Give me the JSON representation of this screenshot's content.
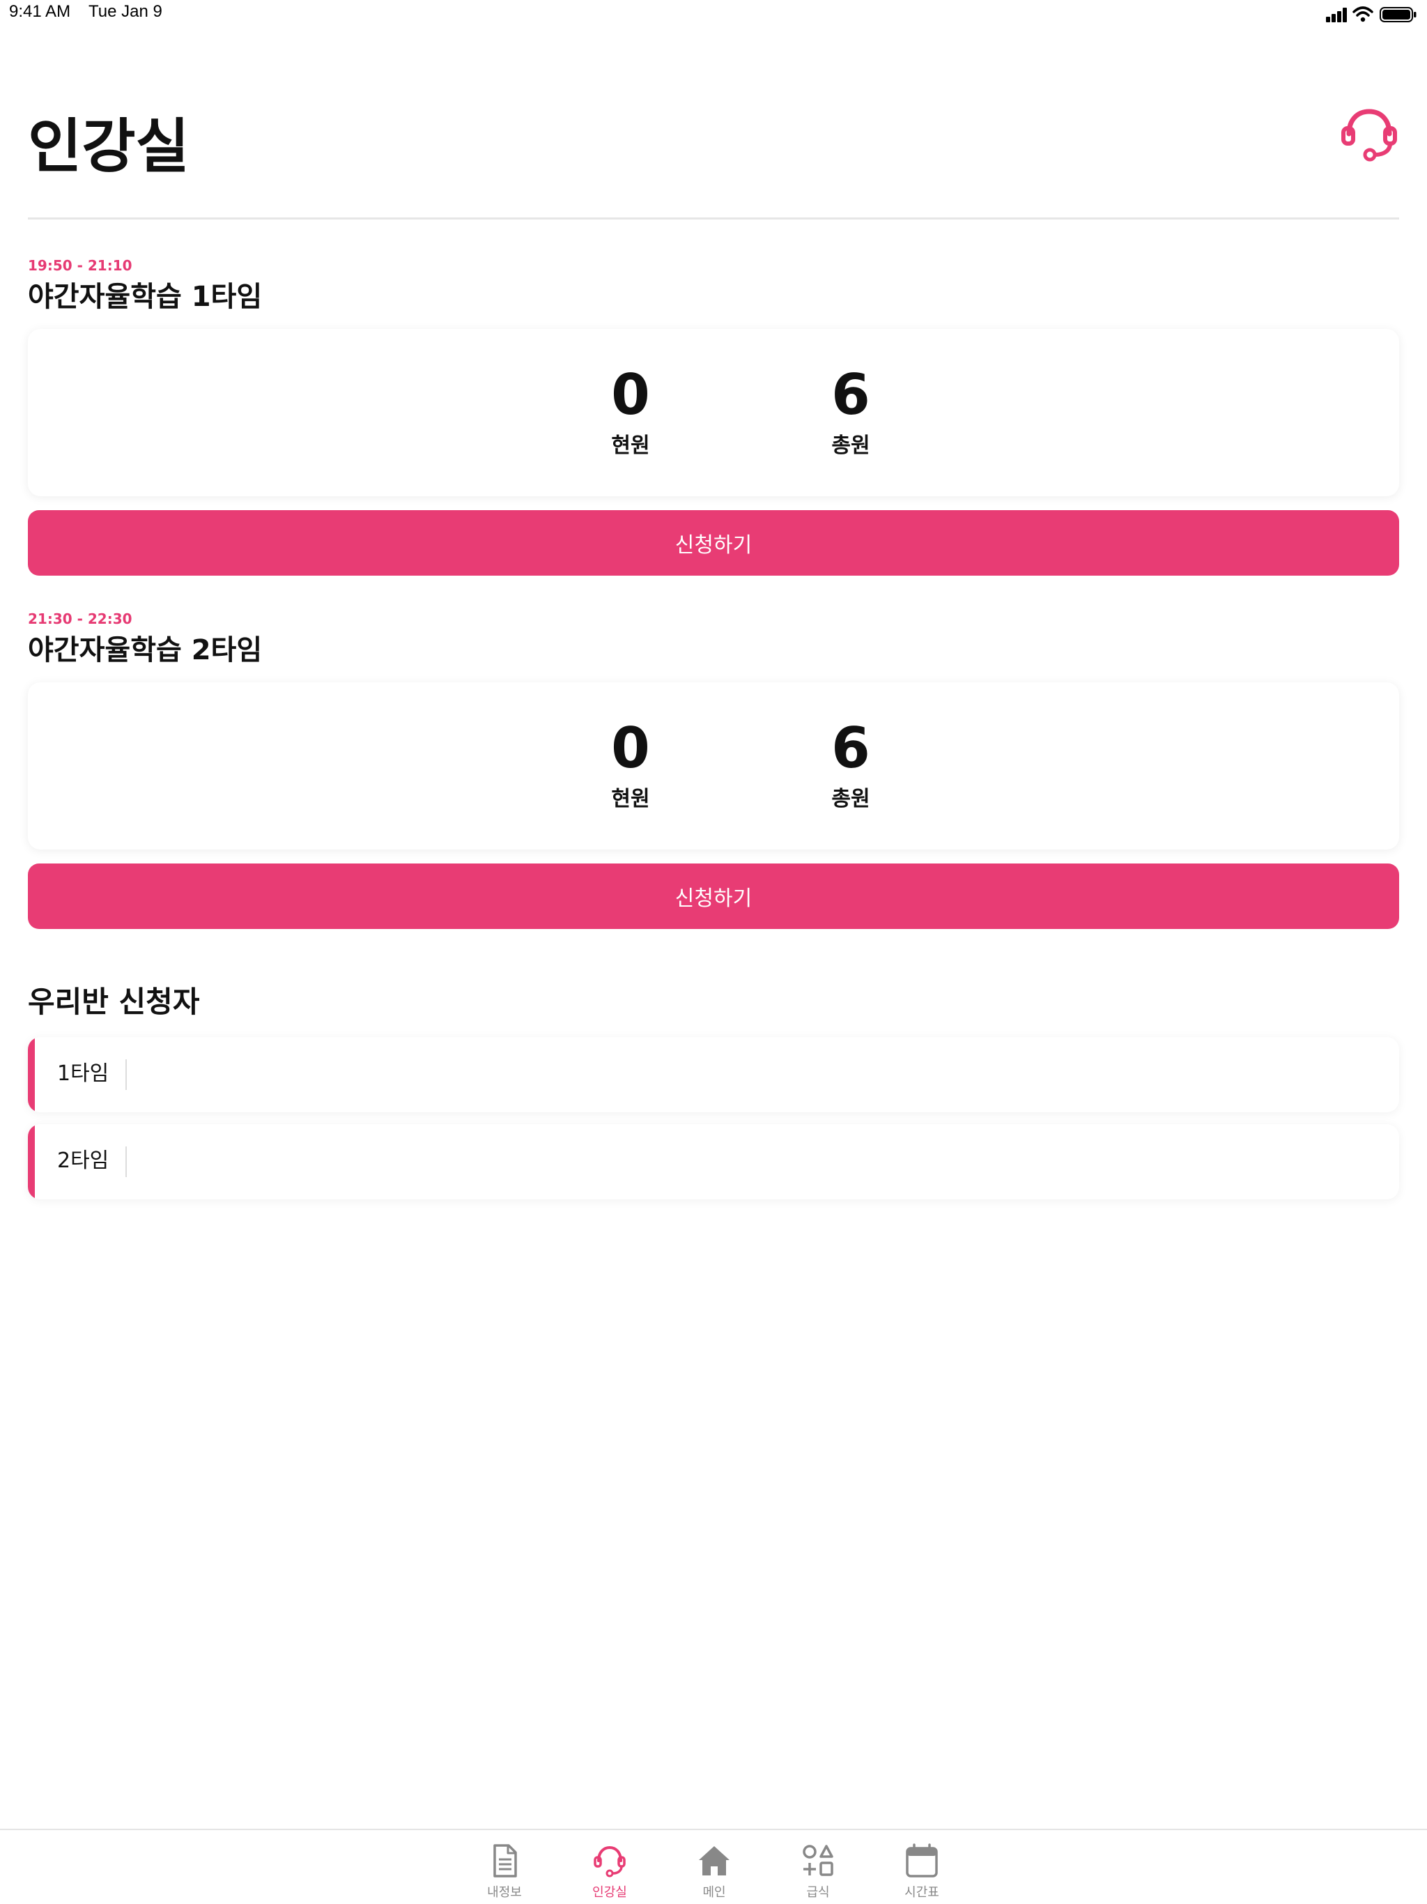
{
  "status_bar": {
    "time": "9:41 AM",
    "date": "Tue Jan 9"
  },
  "header": {
    "title": "인강실",
    "support_icon": "headset-icon"
  },
  "sessions": [
    {
      "time": "19:50 - 21:10",
      "title": "야간자율학습 1타임",
      "current_value": "0",
      "current_label": "현원",
      "total_value": "6",
      "total_label": "총원",
      "apply_label": "신청하기"
    },
    {
      "time": "21:30 - 22:30",
      "title": "야간자율학습 2타임",
      "current_value": "0",
      "current_label": "현원",
      "total_value": "6",
      "total_label": "총원",
      "apply_label": "신청하기"
    }
  ],
  "applicants": {
    "title": "우리반 신청자",
    "rows": [
      {
        "label": "1타임"
      },
      {
        "label": "2타임"
      }
    ]
  },
  "tab_bar": {
    "active_index": 1,
    "tabs": [
      {
        "label": "내정보",
        "icon": "document-icon"
      },
      {
        "label": "인강실",
        "icon": "headset-icon"
      },
      {
        "label": "메인",
        "icon": "home-icon"
      },
      {
        "label": "급식",
        "icon": "meal-icon"
      },
      {
        "label": "시간표",
        "icon": "calendar-icon"
      }
    ]
  },
  "colors": {
    "accent": "#E83C74",
    "text": "#111111",
    "inactive_tab": "#888888"
  }
}
